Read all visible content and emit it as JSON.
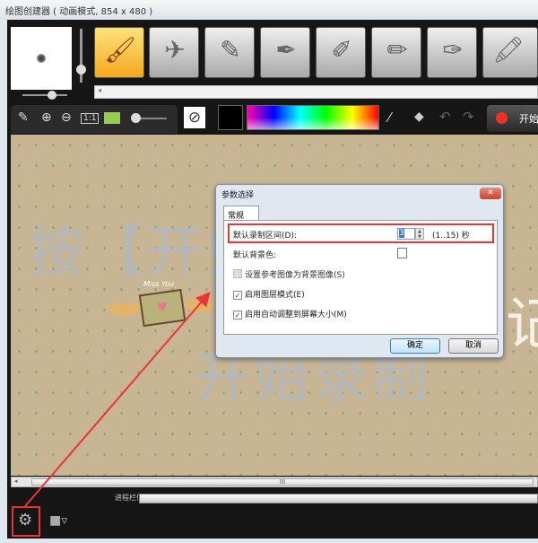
{
  "window": {
    "title": "绘图创建器 ( 动画模式, 854 x 480 )"
  },
  "toolbar": {
    "start_label": "开始",
    "icons": [
      "edit-icon",
      "zoom-in-icon",
      "zoom-out-icon",
      "actual-size-icon",
      "background-image-icon",
      "no-color-icon",
      "eyedropper-icon",
      "eraser-icon",
      "undo-icon",
      "redo-icon",
      "record-icon"
    ],
    "actual_size_label": "1:1",
    "current_color": "#000000"
  },
  "tools": [
    "brush",
    "airbrush",
    "crayon",
    "marker",
    "chalk",
    "pencil",
    "highlighter",
    "paint"
  ],
  "canvas": {
    "watermark_top": "按【开始",
    "watermark_bottom": "开始录制",
    "watermark_right": "记",
    "sticker_text": "Miss You"
  },
  "dialog": {
    "title": "参数选择",
    "close": "✕",
    "tab": "常规",
    "interval_label": "默认录制区间(D):",
    "interval_value": "3",
    "interval_range": "(1..15) 秒",
    "bg_color_label": "默认背景色:",
    "options": [
      {
        "label": "设置参考图像为背景图像(S)",
        "checked": false,
        "enabled": false
      },
      {
        "label": "启用图层模式(E)",
        "checked": true,
        "enabled": true
      },
      {
        "label": "启用自动调整到屏幕大小(M)",
        "checked": true,
        "enabled": true
      }
    ],
    "ok": "确定",
    "cancel": "取消"
  },
  "status": {
    "progress_label": "进程栏信息",
    "scroll_thumb": "III"
  },
  "bottom": {
    "check": "✓"
  },
  "accent": {
    "highlight": "#e33333"
  }
}
